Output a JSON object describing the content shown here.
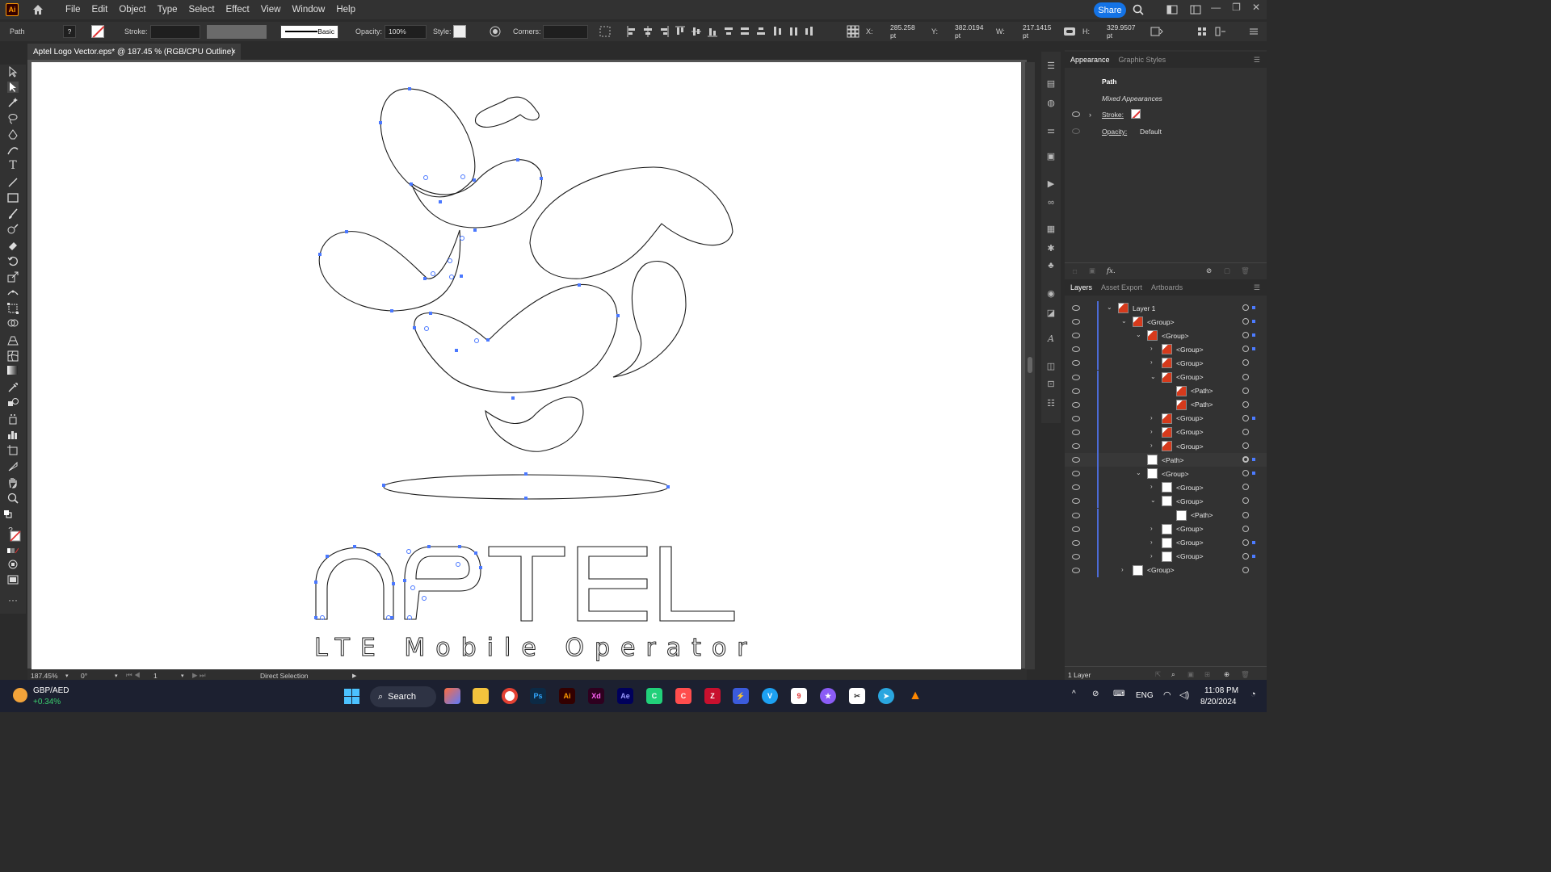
{
  "menubar": {
    "app_icon": "Ai",
    "items": [
      "File",
      "Edit",
      "Object",
      "Type",
      "Select",
      "Effect",
      "View",
      "Window",
      "Help"
    ],
    "share_label": "Share"
  },
  "controlbar": {
    "selection_label": "Path",
    "stroke_label": "Stroke:",
    "brush_label": "Basic",
    "opacity_label": "Opacity:",
    "opacity_value": "100%",
    "style_label": "Style:",
    "corners_label": "Corners:",
    "x_label": "X:",
    "x_value": "285.258 pt",
    "y_label": "Y:",
    "y_value": "382.0194 pt",
    "w_label": "W:",
    "w_value": "217.1415 pt",
    "h_label": "H:",
    "h_value": "329.9507 pt"
  },
  "document": {
    "tab_title": "Aptel Logo Vector.eps* @ 187.45 % (RGB/CPU Outline)",
    "close_icon": "×"
  },
  "artwork": {
    "tagline": "LTE Mobile Operator"
  },
  "statusbar": {
    "zoom": "187.45%",
    "rotation": "0°",
    "artboard_num": "1",
    "tool_name": "Direct Selection"
  },
  "appearance_panel": {
    "tabs": [
      "Appearance",
      "Graphic Styles"
    ],
    "title": "Path",
    "mixed": "Mixed Appearances",
    "stroke_label": "Stroke:",
    "opacity_label": "Opacity:",
    "opacity_value": "Default",
    "fx_label": "fx."
  },
  "layers_panel": {
    "tabs": [
      "Layers",
      "Asset Export",
      "Artboards"
    ],
    "rows": [
      {
        "label": "Layer 1"
      },
      {
        "label": "<Group>"
      },
      {
        "label": "<Group>"
      },
      {
        "label": "<Group>"
      },
      {
        "label": "<Group>"
      },
      {
        "label": "<Group>"
      },
      {
        "label": "<Path>"
      },
      {
        "label": "<Path>"
      },
      {
        "label": "<Group>"
      },
      {
        "label": "<Group>"
      },
      {
        "label": "<Group>"
      },
      {
        "label": "<Path>"
      },
      {
        "label": "<Group>"
      },
      {
        "label": "<Group>"
      },
      {
        "label": "<Group>"
      },
      {
        "label": "<Path>"
      },
      {
        "label": "<Group>"
      },
      {
        "label": "<Group>"
      },
      {
        "label": "<Group>"
      },
      {
        "label": "<Group>"
      }
    ],
    "footer": "1 Layer"
  },
  "taskbar": {
    "ticker_symbol": "GBP/AED",
    "ticker_change": "+0.34%",
    "search_label": "Search",
    "language": "ENG",
    "time": "11:08 PM",
    "date": "8/20/2024"
  }
}
